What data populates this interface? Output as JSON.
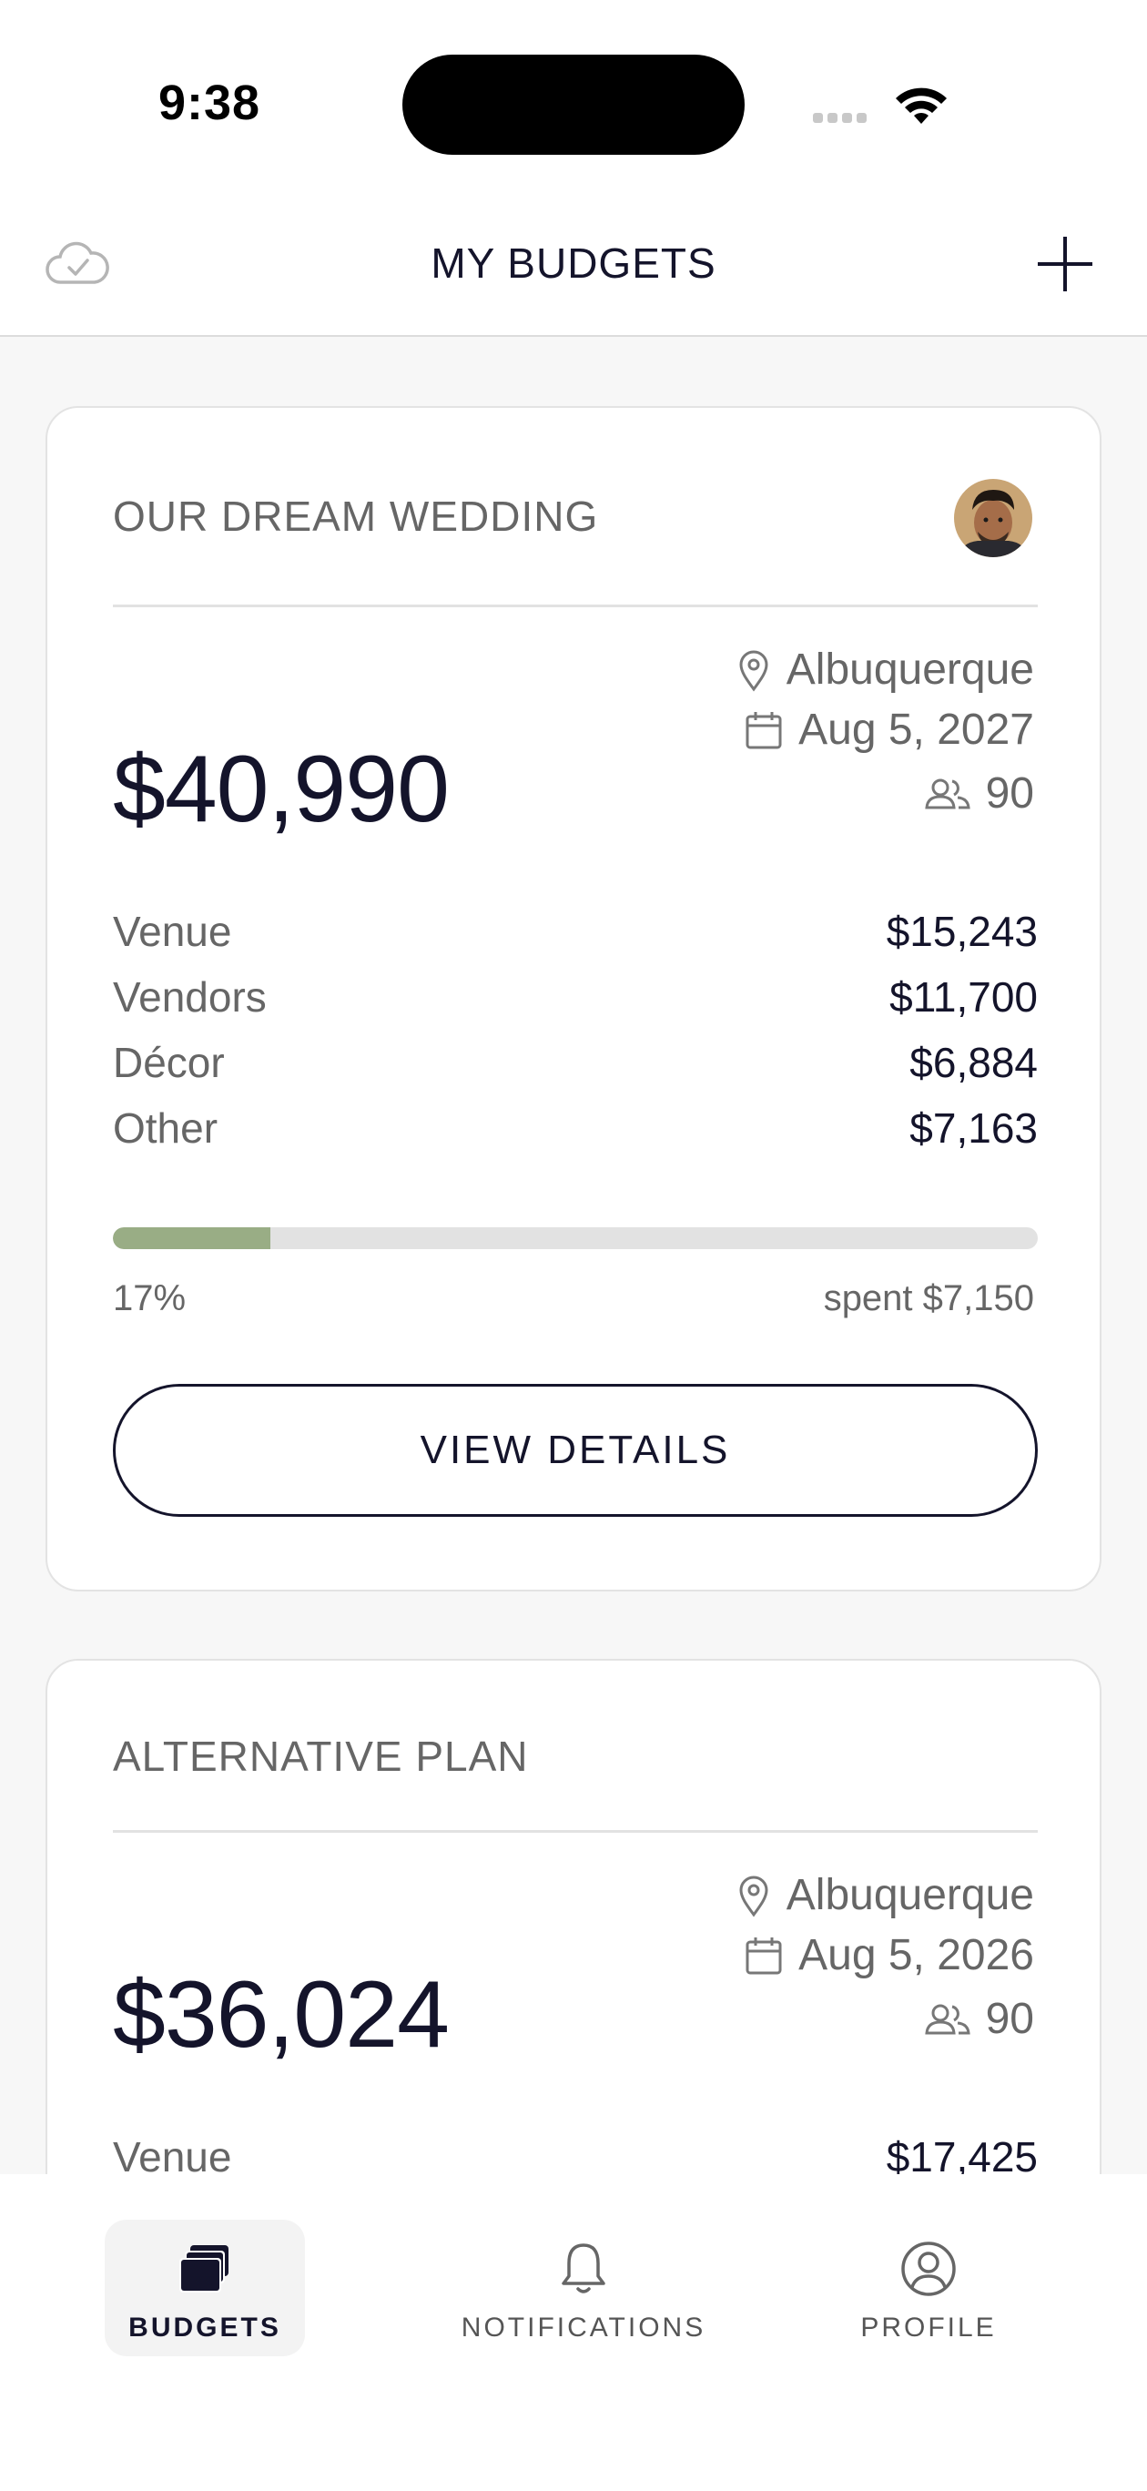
{
  "status_bar": {
    "time": "9:38"
  },
  "header": {
    "title": "MY BUDGETS"
  },
  "budgets": [
    {
      "title": "OUR DREAM WEDDING",
      "total": "$40,990",
      "location": "Albuquerque",
      "date": "Aug 5, 2027",
      "guests": "90",
      "items": [
        {
          "label": "Venue",
          "value": "$15,243"
        },
        {
          "label": "Vendors",
          "value": "$11,700"
        },
        {
          "label": "Décor",
          "value": "$6,884"
        },
        {
          "label": "Other",
          "value": "$7,163"
        }
      ],
      "progress_percent": 17,
      "progress_label": "17%",
      "spent_label": "spent $7,150",
      "button_label": "VIEW DETAILS"
    },
    {
      "title": "ALTERNATIVE PLAN",
      "total": "$36,024",
      "location": "Albuquerque",
      "date": "Aug 5, 2026",
      "guests": "90",
      "items": [
        {
          "label": "Venue",
          "value": "$17,425"
        }
      ]
    }
  ],
  "tabs": [
    {
      "label": "BUDGETS",
      "icon": "budgets-icon",
      "active": true
    },
    {
      "label": "NOTIFICATIONS",
      "icon": "bell-icon",
      "active": false
    },
    {
      "label": "PROFILE",
      "icon": "profile-icon",
      "active": false
    }
  ],
  "colors": {
    "accent": "#14142b",
    "progress": "#99ad85",
    "track": "#e2e2e2",
    "background": "#f7f7f7"
  }
}
